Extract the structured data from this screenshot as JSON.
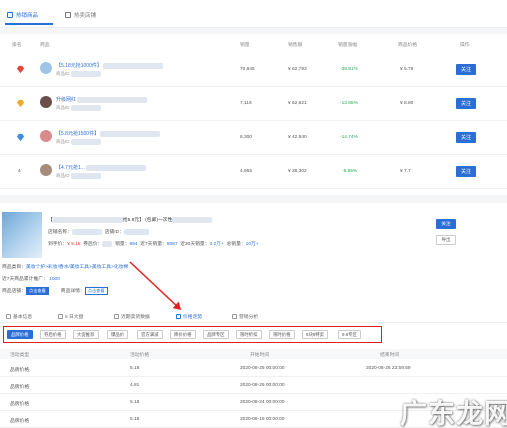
{
  "top_tabs": [
    {
      "label": "热销商品",
      "active": true
    },
    {
      "label": "热卖店铺",
      "active": false
    }
  ],
  "ranking": {
    "headers": [
      "排名",
      "商品",
      "销量",
      "销售额",
      "销量涨幅",
      "商品价格",
      "操作"
    ],
    "rows": [
      {
        "rank_icon": "red-diamond-icon",
        "title": "【5.18元抢1000件】",
        "sub": "商品ID",
        "sales": "70,845",
        "revenue": "¥ 62,793",
        "growth": "-39.81%",
        "price": "¥ 5.79",
        "action": "关注"
      },
      {
        "rank_icon": "gold-diamond-icon",
        "title": "升级网红",
        "sub": "商品ID",
        "sales": "7,116",
        "revenue": "¥ 62,621",
        "growth": "-13.65%",
        "price": "¥ 8.80",
        "action": "关注"
      },
      {
        "rank_icon": "blue-diamond-icon",
        "title": "【5.8元抢1500件】",
        "sub": "商品ID",
        "sales": "8,300",
        "revenue": "¥ 42,840",
        "growth": "-14.74%",
        "price": "",
        "action": "关注"
      },
      {
        "rank_icon": "",
        "rank_num": "4",
        "title": "【4.7元抢1...",
        "sub": "商品ID",
        "sales": "4,955",
        "revenue": "¥ 38,302",
        "growth": "-5.55%",
        "price": "¥ 7.7",
        "action": "关注"
      }
    ]
  },
  "detail": {
    "title": "【",
    "title_tail": "抢5.8元】 (包邮)一次性",
    "shop_label": "店铺名称：",
    "shop_label2": "店铺ID：",
    "price_label": "到手价：",
    "price_value": "¥ 5.18",
    "coupon_label": "券后价：",
    "sales_label": "销量：",
    "sales_value": "994",
    "day_sales_label": "近7天销量：",
    "day_sales_value": "8087",
    "month_label": "近30天销量：",
    "month_value": "3.2万+",
    "total_label": "总销量：",
    "total_value": "10万+",
    "category_label": "商品类目：",
    "category_value": "美妆个护>彩妆/香水/美妆工具>美妆工具>化妆棉",
    "promo_label": "近7天商品累计推广：",
    "promo_value": "1000",
    "shop_link_label": "商品店铺：",
    "shop_link_tag": "点击查看",
    "goods_link_label": "商品详情：",
    "goods_link_tag": "点击查看",
    "btn_follow": "关注",
    "btn_export": "导出"
  },
  "section_tabs": [
    {
      "label": "基本信息",
      "active": false
    },
    {
      "label": "5 日大盘",
      "active": false
    },
    {
      "label": "近期卖货数据",
      "active": false
    },
    {
      "label": "价格走势",
      "active": true
    },
    {
      "label": "营销分析",
      "active": false
    }
  ],
  "chips": [
    {
      "label": "品牌价格",
      "active": true
    },
    {
      "label": "券后价格",
      "active": false
    },
    {
      "label": "大促推荐",
      "active": false
    },
    {
      "label": "爆品价",
      "active": false
    },
    {
      "label": "官方满减",
      "active": false
    },
    {
      "label": "降价价格",
      "active": false
    },
    {
      "label": "品牌专区",
      "active": false
    },
    {
      "label": "限时折扣",
      "active": false
    },
    {
      "label": "限时价格",
      "active": false
    },
    {
      "label": "9块9特卖",
      "active": false
    },
    {
      "label": "9.9专区",
      "active": false
    }
  ],
  "history": {
    "headers": [
      "活动类型",
      "活动价格",
      "开始时间",
      "结束时间"
    ],
    "rows": [
      {
        "type": "品牌价格",
        "price": "5.18",
        "start": "2020-08-25 00:00:00",
        "end": "2020-08-26 23:59:59"
      },
      {
        "type": "品牌价格",
        "price": "4.81",
        "start": "2020-08-25 00:00:00",
        "end": ""
      },
      {
        "type": "品牌价格",
        "price": "5.18",
        "start": "2020-08-24 00:00:00",
        "end": ""
      },
      {
        "type": "品牌价格",
        "price": "5.18",
        "start": "2020-08-19 00:00:00",
        "end": ""
      }
    ]
  },
  "watermark": "广东龙网",
  "colors": {
    "accent": "#2b6fd6",
    "highlight_box": "#e02020",
    "negative": "#26a65b",
    "price": "#e0432b"
  }
}
